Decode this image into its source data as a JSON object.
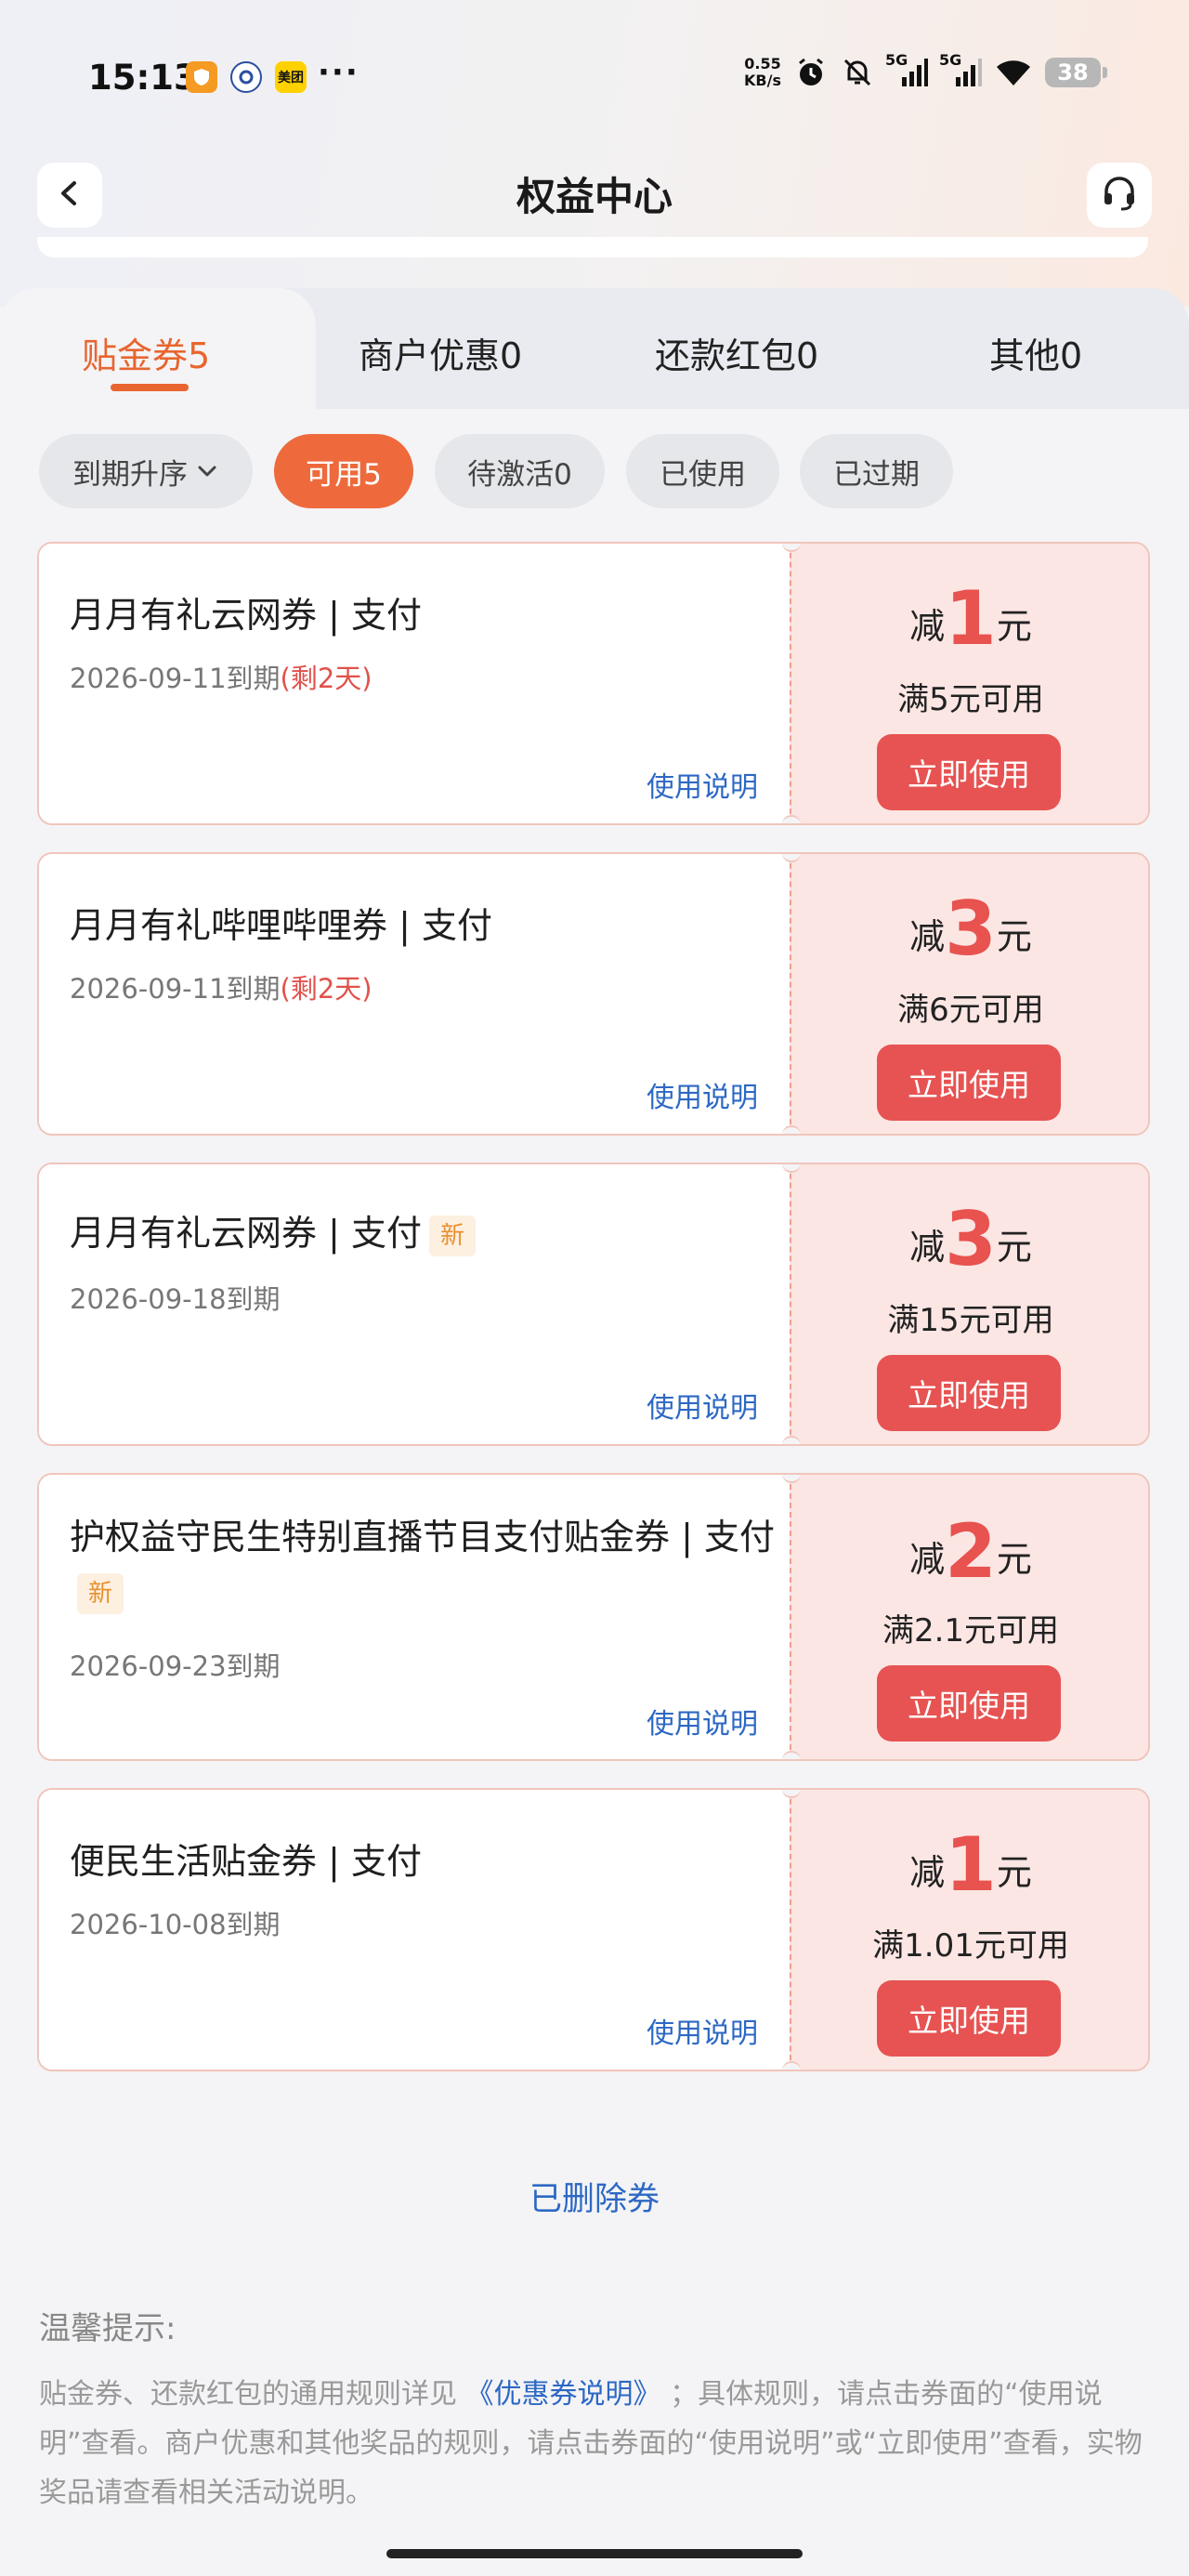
{
  "status_bar": {
    "time": "15:13",
    "apps": [
      "shield-app",
      "baidu-app",
      "美团"
    ],
    "net_speed_value": "0.55",
    "net_speed_unit": "KB/s",
    "network_1": "5G",
    "network_2": "5G",
    "battery": "38"
  },
  "header": {
    "title": "权益中心",
    "icons": [
      "chevron-left-icon",
      "headset-icon"
    ]
  },
  "tabs": [
    {
      "label": "贴金券5",
      "active": true
    },
    {
      "label": "商户优惠0",
      "active": false
    },
    {
      "label": "还款红包0",
      "active": false
    },
    {
      "label": "其他0",
      "active": false
    }
  ],
  "filters": [
    {
      "label": "到期升序",
      "has_chevron": true,
      "active": false
    },
    {
      "label": "可用5",
      "active": true
    },
    {
      "label": "待激活0",
      "active": false
    },
    {
      "label": "已使用",
      "active": false
    },
    {
      "label": "已过期",
      "active": false
    }
  ],
  "coupons": [
    {
      "title": "月月有礼云网券 | 支付",
      "is_new": false,
      "date": "2026-09-11到期",
      "remain": "(剩2天)",
      "rules": "使用说明",
      "prefix": "减",
      "amount": "1",
      "unit": "元",
      "condition": "满5元可用",
      "use_label": "立即使用"
    },
    {
      "title": "月月有礼哔哩哔哩券 | 支付",
      "is_new": false,
      "date": "2026-09-11到期",
      "remain": "(剩2天)",
      "rules": "使用说明",
      "prefix": "减",
      "amount": "3",
      "unit": "元",
      "condition": "满6元可用",
      "use_label": "立即使用"
    },
    {
      "title": "月月有礼云网券 | 支付",
      "is_new": true,
      "new_label": "新",
      "date": "2026-09-18到期",
      "remain": "",
      "rules": "使用说明",
      "prefix": "减",
      "amount": "3",
      "unit": "元",
      "condition": "满15元可用",
      "use_label": "立即使用"
    },
    {
      "title": "护权益守民生特别直播节目支付贴金券 | 支付",
      "is_new": true,
      "new_label": "新",
      "date": "2026-09-23到期",
      "remain": "",
      "rules": "使用说明",
      "prefix": "减",
      "amount": "2",
      "unit": "元",
      "condition": "满2.1元可用",
      "use_label": "立即使用"
    },
    {
      "title": "便民生活贴金券 | 支付",
      "is_new": false,
      "date": "2026-10-08到期",
      "remain": "",
      "rules": "使用说明",
      "prefix": "减",
      "amount": "1",
      "unit": "元",
      "condition": "满1.01元可用",
      "use_label": "立即使用"
    }
  ],
  "deleted_link": "已删除券",
  "tips": {
    "title": "温馨提示:",
    "text_1": "贴金券、还款红包的通用规则详见",
    "link": "《优惠券说明》",
    "text_2": "；具体规则，请点击券面的“使用说明”查看。商户优惠和其他奖品的规则，请点击券面的“使用说明”或“立即使用”查看，实物奖品请查看相关活动说明。"
  },
  "colors": {
    "accent": "#e8652f",
    "coupon_red": "#e65352",
    "link_blue": "#2d68c4"
  }
}
